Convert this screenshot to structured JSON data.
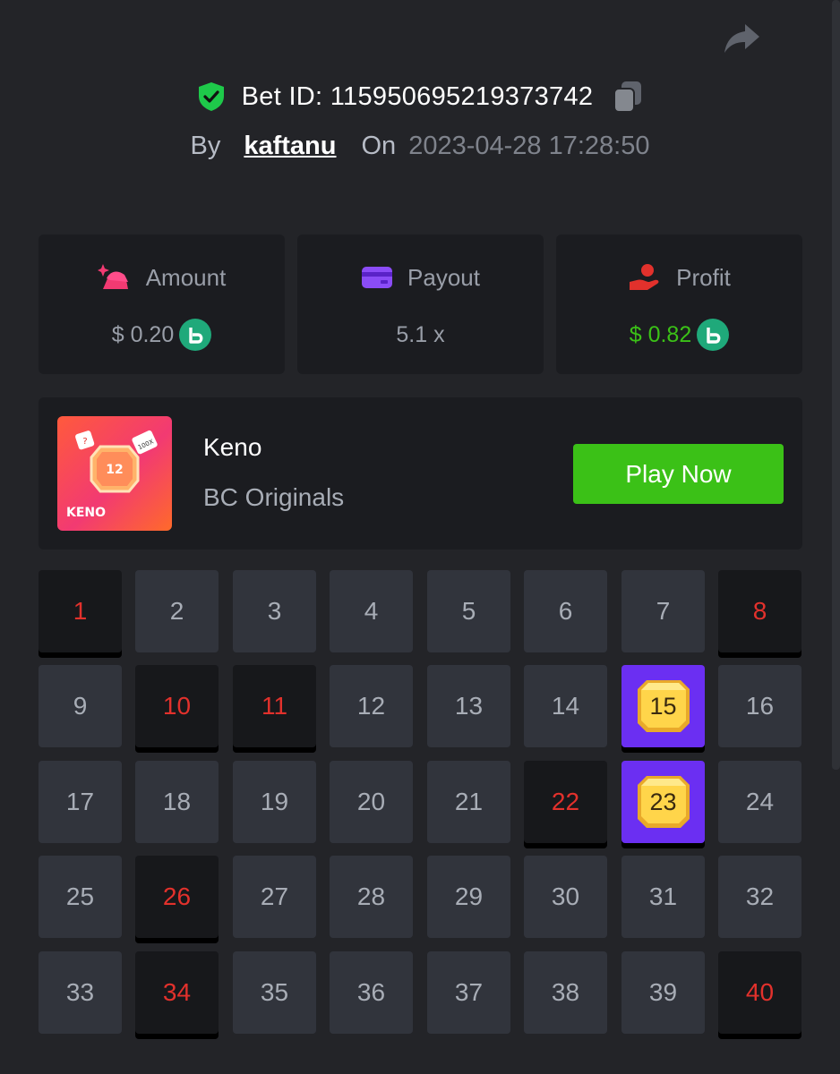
{
  "header": {
    "bet_id_label": "Bet ID: 115950695219373742",
    "by_label": "By",
    "username": "kaftanu",
    "on_label": "On",
    "datetime": "2023-04-28 17:28:50",
    "verified_color": "#1ec94a"
  },
  "stats": {
    "amount_label": "Amount",
    "amount_value": "$ 0.20",
    "payout_label": "Payout",
    "payout_value": "5.1 x",
    "profit_label": "Profit",
    "profit_value": "$ 0.82",
    "profit_color": "#3bc117"
  },
  "game": {
    "title": "Keno",
    "provider": "BC Originals",
    "play_label": "Play Now",
    "thumb_number": "12",
    "thumb_label": "KENO",
    "thumb_badge_left": "?",
    "thumb_badge_right": "100X"
  },
  "grid": {
    "numbers": [
      "1",
      "2",
      "3",
      "4",
      "5",
      "6",
      "7",
      "8",
      "9",
      "10",
      "11",
      "12",
      "13",
      "14",
      "15",
      "16",
      "17",
      "18",
      "19",
      "20",
      "21",
      "22",
      "23",
      "24",
      "25",
      "26",
      "27",
      "28",
      "29",
      "30",
      "31",
      "32",
      "33",
      "34",
      "35",
      "36",
      "37",
      "38",
      "39",
      "40"
    ],
    "selected_missed": [
      1,
      8,
      10,
      11,
      22,
      26,
      34,
      40
    ],
    "hits": [
      15,
      23
    ],
    "miss_color": "#e2312c",
    "hit_color": "#6b2ff2"
  }
}
